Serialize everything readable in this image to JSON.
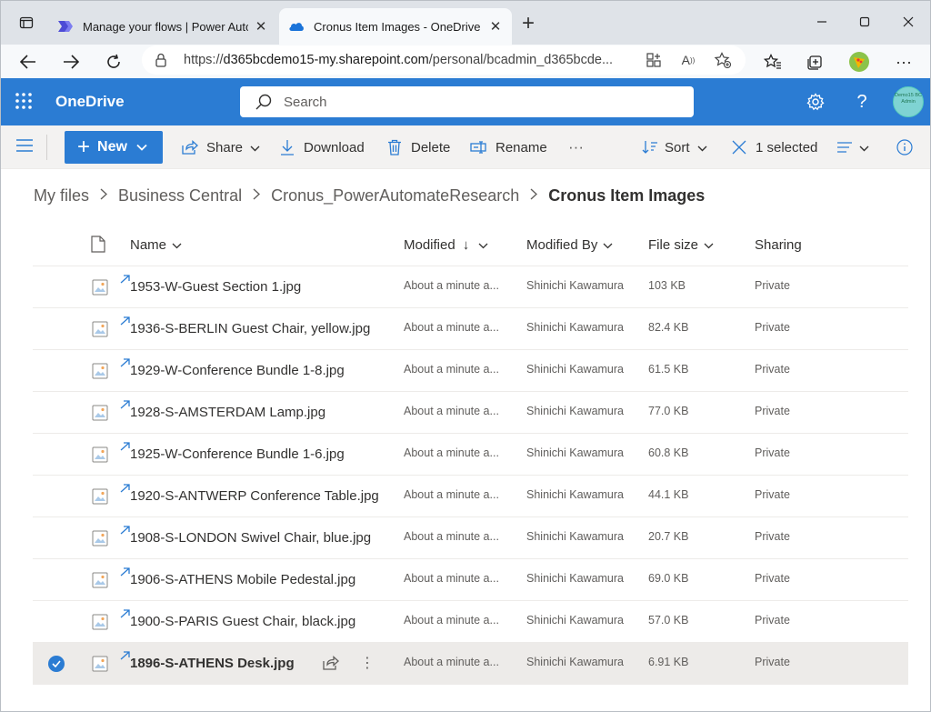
{
  "browser": {
    "tabs": [
      {
        "title": "Manage your flows | Power Autom",
        "active": false
      },
      {
        "title": "Cronus Item Images - OneDrive",
        "active": true
      }
    ],
    "url_prefix": "https://",
    "url_host": "d365bcdemo15-my.sharepoint.com",
    "url_path": "/personal/bcadmin_d365bcde..."
  },
  "header": {
    "app_name": "OneDrive",
    "search_placeholder": "Search",
    "avatar_text": "Demo15 BC Admin"
  },
  "commands": {
    "new": "New",
    "share": "Share",
    "download": "Download",
    "delete": "Delete",
    "rename": "Rename",
    "more": "···",
    "sort": "Sort",
    "selected": "1 selected"
  },
  "breadcrumb": [
    "My files",
    "Business Central",
    "Cronus_PowerAutomateResearch",
    "Cronus Item Images"
  ],
  "columns": {
    "name": "Name",
    "modified": "Modified",
    "modified_sort": "↓",
    "modified_by": "Modified By",
    "file_size": "File size",
    "sharing": "Sharing"
  },
  "files": [
    {
      "name": "1953-W-Guest Section 1.jpg",
      "modified": "About a minute a...",
      "modified_by": "Shinichi Kawamura",
      "size": "103 KB",
      "sharing": "Private"
    },
    {
      "name": "1936-S-BERLIN Guest Chair, yellow.jpg",
      "modified": "About a minute a...",
      "modified_by": "Shinichi Kawamura",
      "size": "82.4 KB",
      "sharing": "Private"
    },
    {
      "name": "1929-W-Conference Bundle 1-8.jpg",
      "modified": "About a minute a...",
      "modified_by": "Shinichi Kawamura",
      "size": "61.5 KB",
      "sharing": "Private"
    },
    {
      "name": "1928-S-AMSTERDAM Lamp.jpg",
      "modified": "About a minute a...",
      "modified_by": "Shinichi Kawamura",
      "size": "77.0 KB",
      "sharing": "Private"
    },
    {
      "name": "1925-W-Conference Bundle 1-6.jpg",
      "modified": "About a minute a...",
      "modified_by": "Shinichi Kawamura",
      "size": "60.8 KB",
      "sharing": "Private"
    },
    {
      "name": "1920-S-ANTWERP Conference Table.jpg",
      "modified": "About a minute a...",
      "modified_by": "Shinichi Kawamura",
      "size": "44.1 KB",
      "sharing": "Private"
    },
    {
      "name": "1908-S-LONDON Swivel Chair, blue.jpg",
      "modified": "About a minute a...",
      "modified_by": "Shinichi Kawamura",
      "size": "20.7 KB",
      "sharing": "Private"
    },
    {
      "name": "1906-S-ATHENS Mobile Pedestal.jpg",
      "modified": "About a minute a...",
      "modified_by": "Shinichi Kawamura",
      "size": "69.0 KB",
      "sharing": "Private"
    },
    {
      "name": "1900-S-PARIS Guest Chair, black.jpg",
      "modified": "About a minute a...",
      "modified_by": "Shinichi Kawamura",
      "size": "57.0 KB",
      "sharing": "Private"
    },
    {
      "name": "1896-S-ATHENS Desk.jpg",
      "modified": "About a minute a...",
      "modified_by": "Shinichi Kawamura",
      "size": "6.91 KB",
      "sharing": "Private",
      "selected": true
    }
  ],
  "colors": {
    "accent": "#2b7cd3",
    "selected_row": "#edebe9"
  }
}
